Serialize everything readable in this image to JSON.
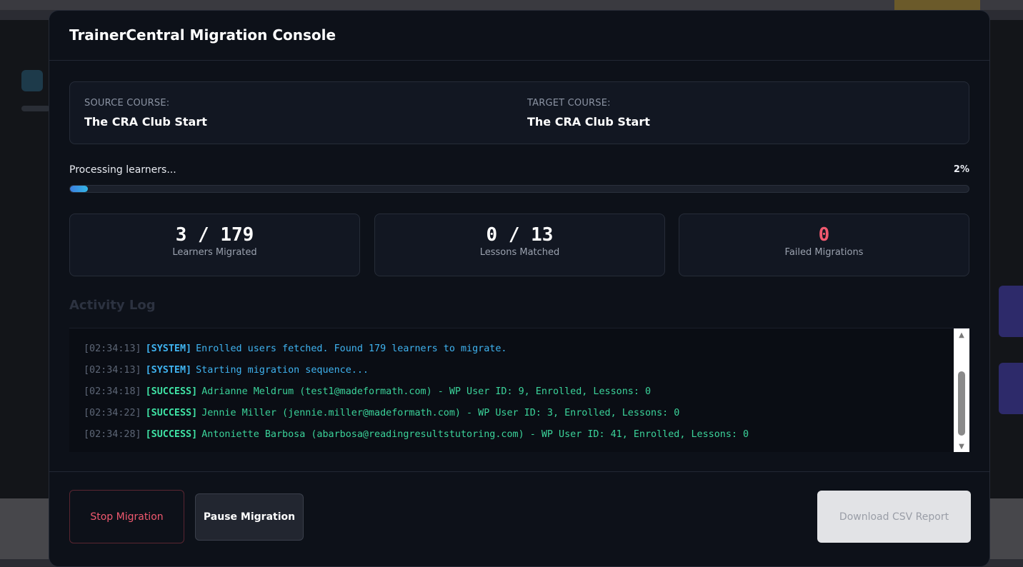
{
  "modal": {
    "title": "TrainerCentral Migration Console"
  },
  "source": {
    "label": "SOURCE COURSE:",
    "name": "The CRA Club Start"
  },
  "target": {
    "label": "TARGET COURSE:",
    "name": "The CRA Club Start"
  },
  "progress": {
    "label": "Processing learners...",
    "percent_text": "2%",
    "fraction": 0.02
  },
  "stats": [
    {
      "value": "3 / 179",
      "label": "Learners Migrated"
    },
    {
      "value": "0 / 13",
      "label": "Lessons Matched"
    },
    {
      "value": "0",
      "label": "Failed Migrations"
    }
  ],
  "log": {
    "heading": "Activity Log",
    "entries": [
      {
        "time": "[02:34:13]",
        "tag": "[SYSTEM]",
        "message": "Enrolled users fetched. Found 179 learners to migrate.",
        "kind": "system"
      },
      {
        "time": "[02:34:13]",
        "tag": "[SYSTEM]",
        "message": "Starting migration sequence...",
        "kind": "system"
      },
      {
        "time": "[02:34:18]",
        "tag": "[SUCCESS]",
        "message": "Adrianne Meldrum (test1@madeformath.com) - WP User ID: 9, Enrolled, Lessons: 0",
        "kind": "success"
      },
      {
        "time": "[02:34:22]",
        "tag": "[SUCCESS]",
        "message": "Jennie Miller (jennie.miller@madeformath.com) - WP User ID: 3, Enrolled, Lessons: 0",
        "kind": "success"
      },
      {
        "time": "[02:34:28]",
        "tag": "[SUCCESS]",
        "message": "Antoniette Barbosa (abarbosa@readingresultstutoring.com) - WP User ID: 41, Enrolled, Lessons: 0",
        "kind": "success"
      }
    ]
  },
  "footer": {
    "stop_label": "Stop Migration",
    "pause_label": "Pause Migration",
    "download_label": "Download CSV Report"
  },
  "icons": {
    "scroll_up": "triangle-up-icon",
    "scroll_down": "triangle-down-icon"
  },
  "colors": {
    "accent_progress": "#3d7fe0",
    "failed": "#f0596f",
    "system_log": "#3fb3f0",
    "success_log": "#3bd39a"
  }
}
